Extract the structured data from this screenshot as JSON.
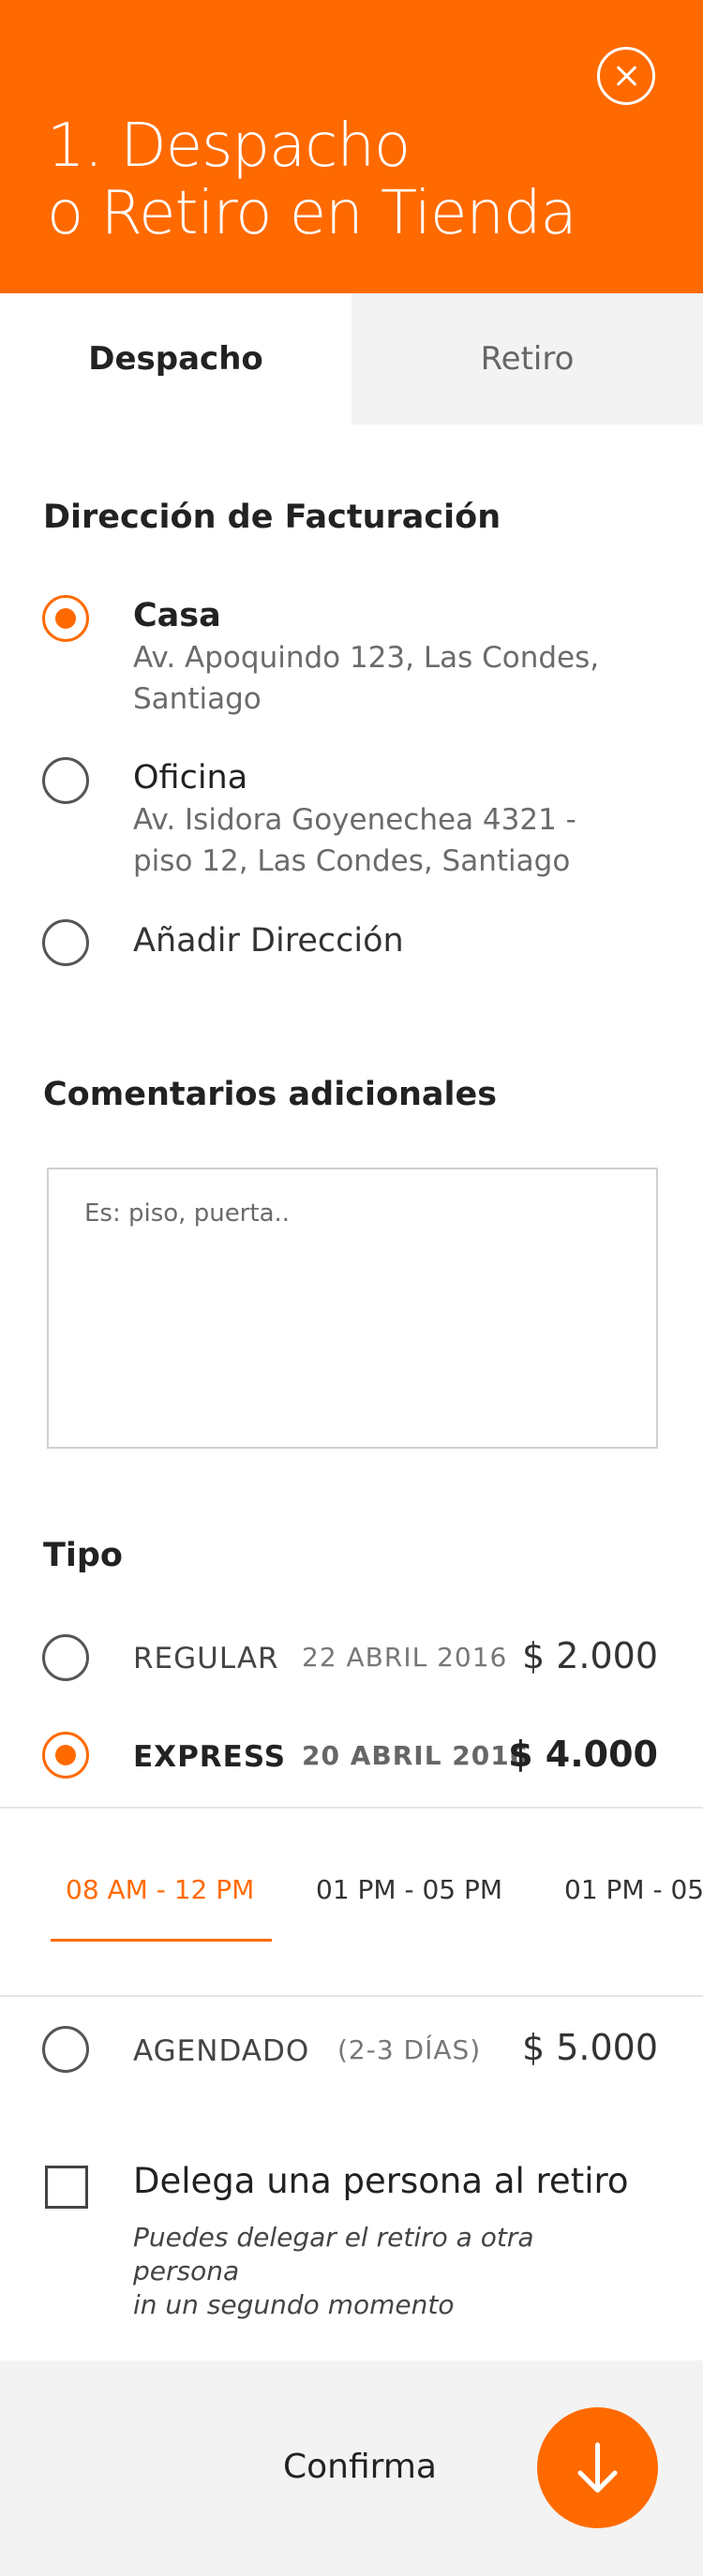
{
  "header": {
    "title_line1": "1. Despacho",
    "title_line2": "o Retiro en Tienda",
    "close_icon": "close-icon",
    "accent_color": "#FF6A00"
  },
  "tabs": [
    {
      "label": "Despacho",
      "active": true
    },
    {
      "label": "Retiro",
      "active": false
    }
  ],
  "billing": {
    "title": "Dirección de Facturación",
    "options": [
      {
        "label": "Casa",
        "address_line1": "Av. Apoquindo 123, Las Condes,",
        "address_line2": "Santiago",
        "selected": true
      },
      {
        "label": "Oficina",
        "address_line1": "Av. Isidora Goyenechea 4321 -",
        "address_line2": "piso 12, Las Condes, Santiago",
        "selected": false
      },
      {
        "label": "Añadir Dirección",
        "selected": false
      }
    ]
  },
  "comments": {
    "title": "Comentarios adicionales",
    "placeholder": "Es: piso, puerta.."
  },
  "tipo": {
    "title": "Tipo",
    "options": [
      {
        "name": "REGULAR",
        "date": "22 ABRIL 2016",
        "price": "$ 2.000",
        "selected": false
      },
      {
        "name": "EXPRESS",
        "date": "20 ABRIL 2016",
        "price": "$ 4.000",
        "selected": true
      },
      {
        "name": "AGENDADO",
        "date": "(2-3 DÍAS)",
        "price": "$ 5.000",
        "selected": false
      }
    ],
    "time_slots": [
      {
        "label": "08 AM - 12 PM",
        "active": true
      },
      {
        "label": "01 PM - 05 PM",
        "active": false
      },
      {
        "label": "01 PM - 05",
        "active": false
      }
    ]
  },
  "delegate": {
    "label": "Delega una persona al retiro",
    "sub_line1": "Puedes delegar el retiro a otra persona",
    "sub_line2": "in un segundo momento",
    "checked": false
  },
  "footer": {
    "confirm_label": "Confirma",
    "confirm_icon": "arrow-down-icon"
  }
}
